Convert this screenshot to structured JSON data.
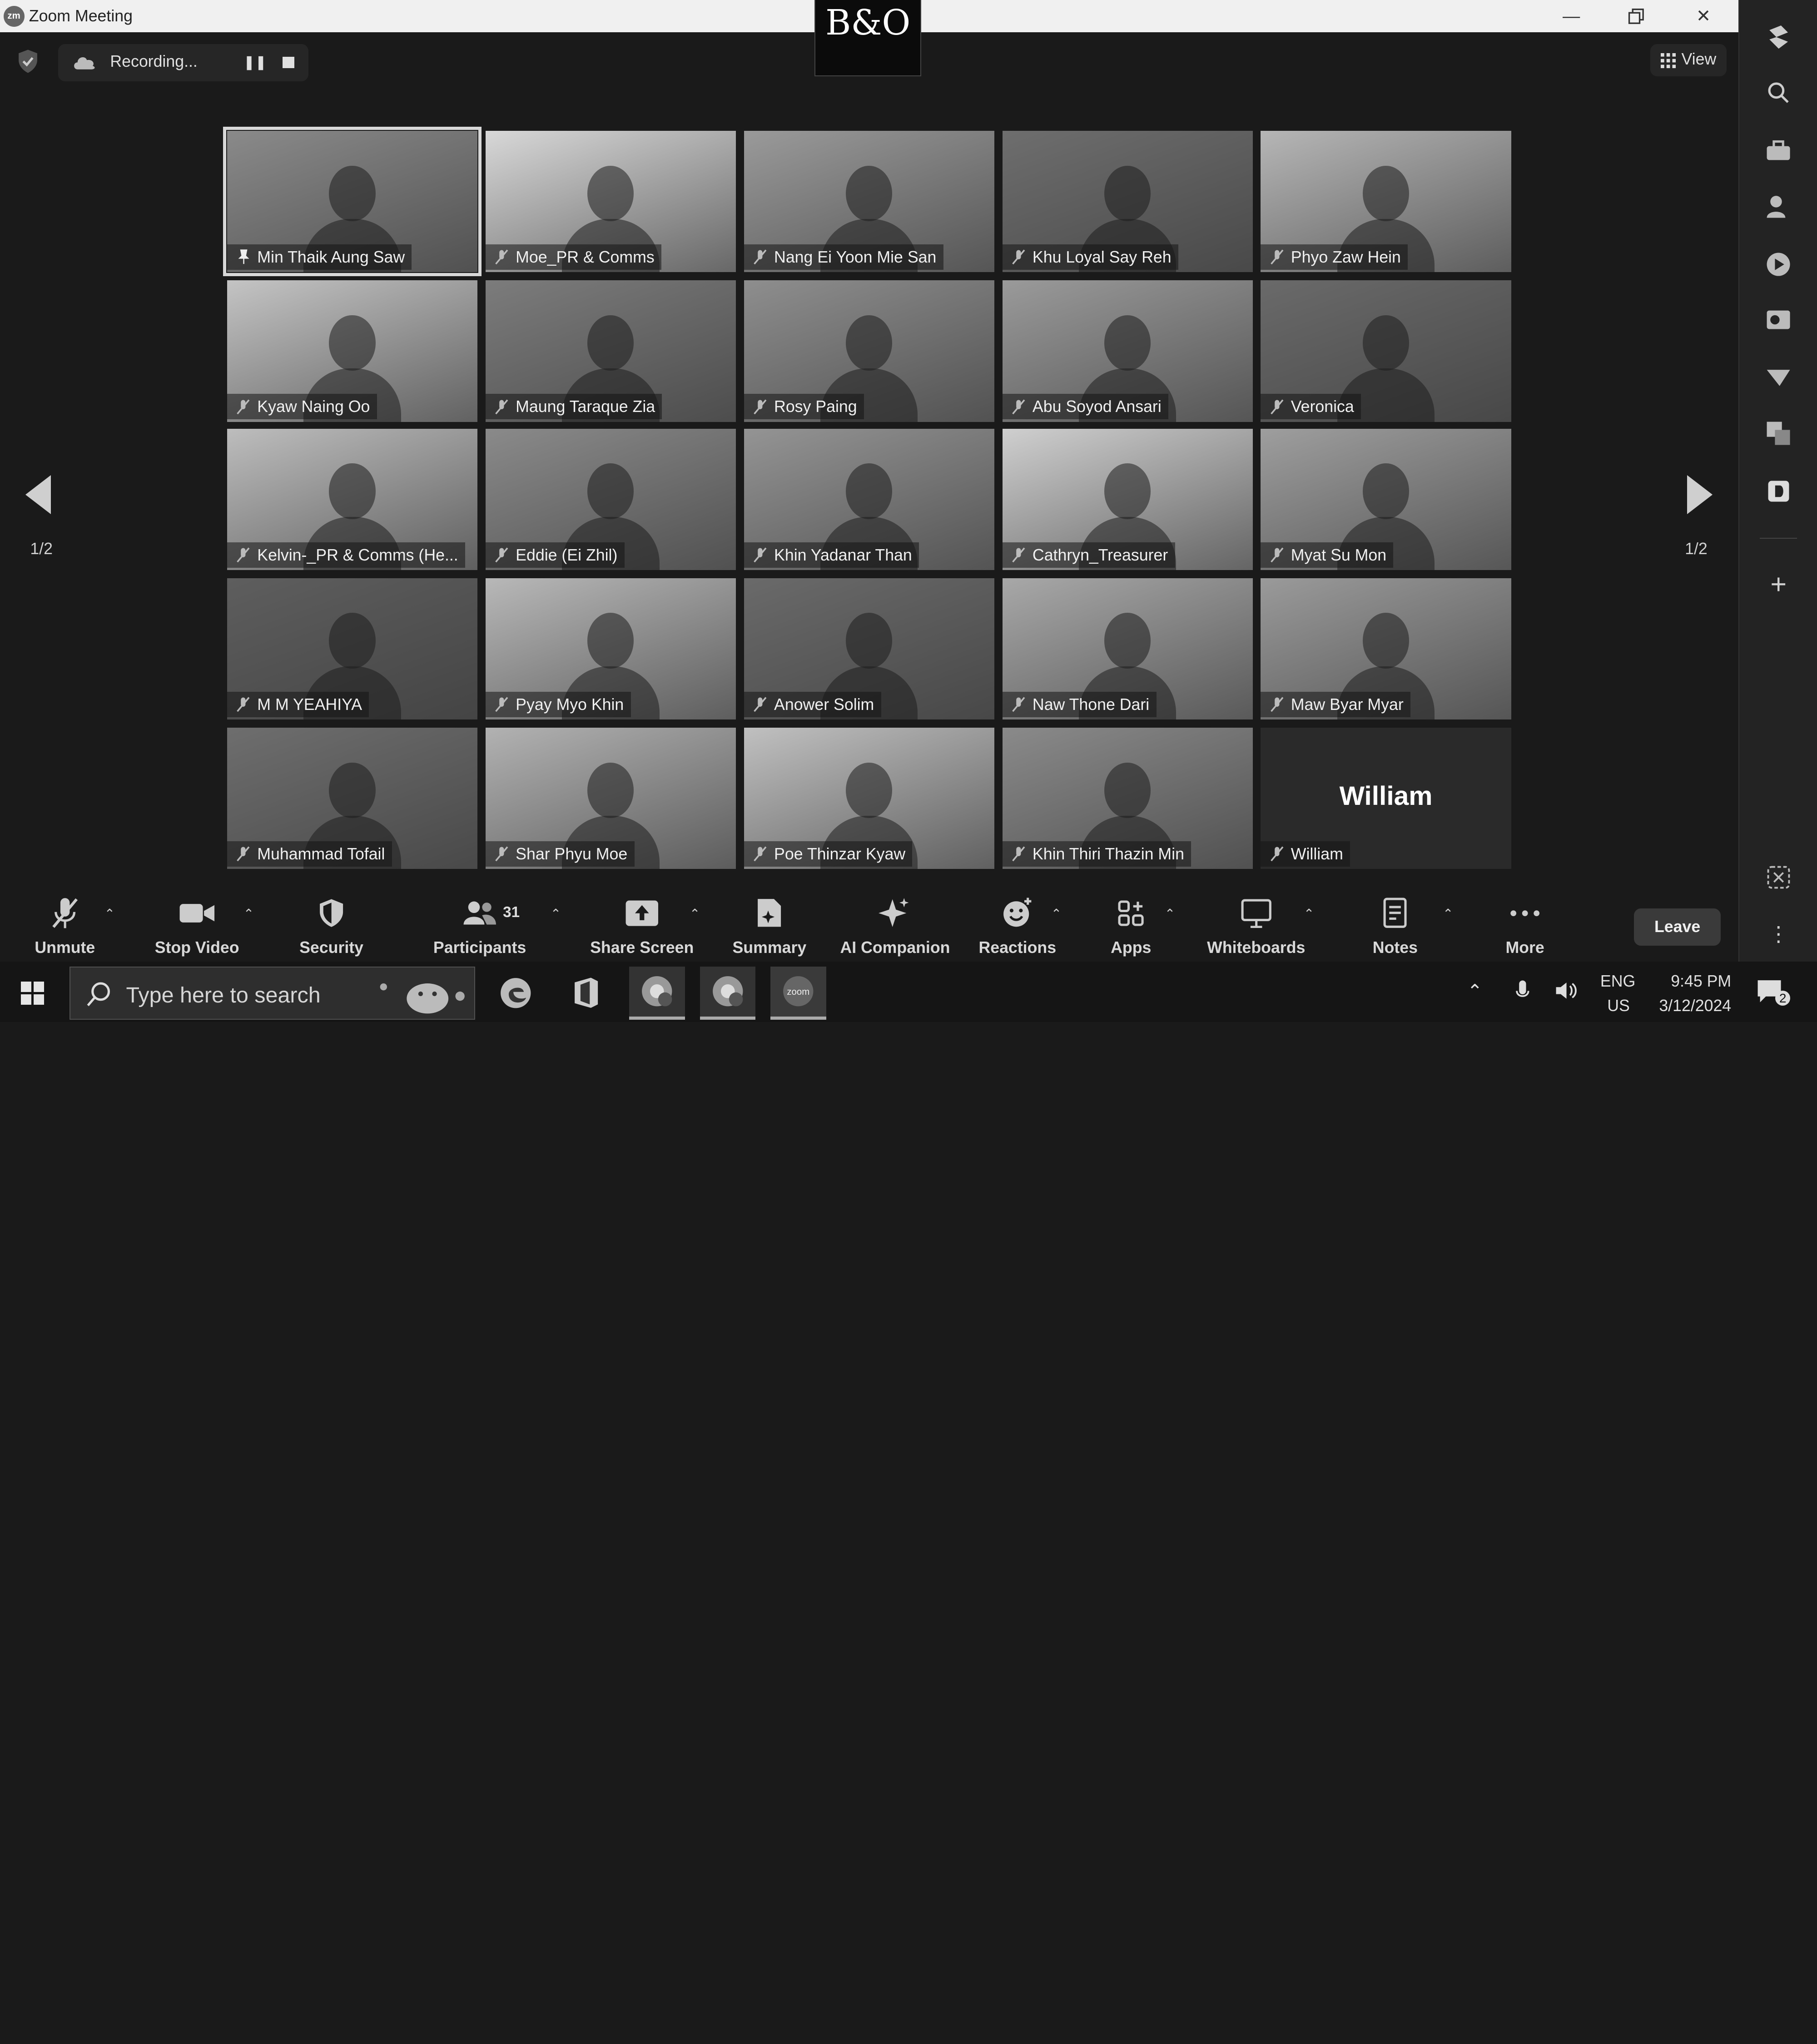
{
  "window": {
    "title": "Zoom Meeting",
    "logo_text": "B&O"
  },
  "topbar": {
    "recording_label": "Recording...",
    "view_label": "View"
  },
  "page_indicator": {
    "left": "1/2",
    "right": "1/2"
  },
  "participants": [
    {
      "name": "Min Thaik Aung Saw",
      "active": true,
      "shade": "#8a8a8a"
    },
    {
      "name": "Moe_PR & Comms",
      "shade": "#d8d8d8"
    },
    {
      "name": "Nang Ei Yoon Mie San",
      "shade": "#9a9a9a"
    },
    {
      "name": "Khu Loyal Say Reh",
      "shade": "#6e6e6e"
    },
    {
      "name": "Phyo Zaw Hein",
      "shade": "#b6b6b6"
    },
    {
      "name": "Kyaw Naing Oo",
      "shade": "#c4c4c4"
    },
    {
      "name": "Maung Taraque Zia",
      "shade": "#7c7c7c"
    },
    {
      "name": "Rosy Paing",
      "shade": "#8e8e8e"
    },
    {
      "name": "Abu Soyod Ansari",
      "shade": "#9a9a9a"
    },
    {
      "name": "Veronica",
      "shade": "#6a6a6a"
    },
    {
      "name": "Kelvin-_PR & Comms (He...",
      "shade": "#bdbdbd"
    },
    {
      "name": "Eddie (Ei Zhil)",
      "shade": "#8a8a8a"
    },
    {
      "name": "Khin Yadanar Than",
      "shade": "#949494"
    },
    {
      "name": "Cathryn_Treasurer",
      "shade": "#cfcfcf"
    },
    {
      "name": "Myat Su Mon",
      "shade": "#9e9e9e"
    },
    {
      "name": "M M YEAHIYA",
      "shade": "#5e5e5e"
    },
    {
      "name": "Pyay Myo Khin",
      "shade": "#b8b8b8"
    },
    {
      "name": "Anower Solim",
      "shade": "#6a6a6a"
    },
    {
      "name": "Naw Thone Dari",
      "shade": "#a8a8a8"
    },
    {
      "name": "Maw Byar Myar",
      "shade": "#9a9a9a"
    },
    {
      "name": "Muhammad Tofail",
      "shade": "#6e6e6e"
    },
    {
      "name": "Shar Phyu Moe",
      "shade": "#b2b2b2"
    },
    {
      "name": "Poe Thinzar Kyaw",
      "shade": "#c0c0c0"
    },
    {
      "name": "Khin Thiri Thazin Min",
      "shade": "#8a8a8a"
    },
    {
      "name": "William",
      "shade": "#2a2a2a",
      "avatar_text": "William"
    }
  ],
  "toolbar": {
    "unmute": "Unmute",
    "stop_video": "Stop Video",
    "security": "Security",
    "participants": "Participants",
    "participant_count": "31",
    "share_screen": "Share Screen",
    "summary": "Summary",
    "ai_companion": "AI Companion",
    "reactions": "Reactions",
    "apps": "Apps",
    "whiteboards": "Whiteboards",
    "notes": "Notes",
    "more": "More",
    "leave": "Leave"
  },
  "taskbar": {
    "search_placeholder": "Type here to search",
    "lang": "ENG",
    "region": "US",
    "time": "9:45 PM",
    "date": "3/12/2024",
    "notifications": "2"
  }
}
